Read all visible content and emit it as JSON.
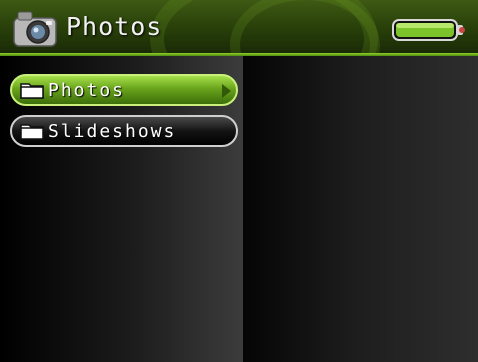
{
  "header": {
    "title": "Photos",
    "app_icon": "camera-icon",
    "status_icon": "battery-icon",
    "battery_level": 1.0
  },
  "menu": {
    "items": [
      {
        "label": "Photos",
        "icon": "folder-icon",
        "selected": true
      },
      {
        "label": "Slideshows",
        "icon": "folder-icon",
        "selected": false
      }
    ]
  },
  "colors": {
    "accent": "#6aa41c",
    "header_bg": "#2a420a",
    "text": "#ffffff"
  }
}
